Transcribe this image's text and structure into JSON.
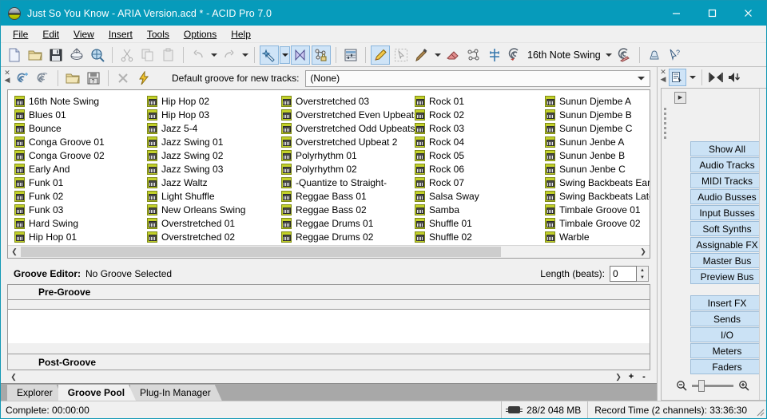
{
  "window": {
    "title": "Just So You Know - ARIA Version.acd * - ACID Pro 7.0",
    "app_icon": "acid-app-icon",
    "minimize": "–",
    "maximize": "□",
    "close": "✕",
    "accent_color": "#069bbb"
  },
  "menu": [
    {
      "label": "File",
      "accel": "F"
    },
    {
      "label": "Edit",
      "accel": "E"
    },
    {
      "label": "View",
      "accel": "V"
    },
    {
      "label": "Insert",
      "accel": "I"
    },
    {
      "label": "Tools",
      "accel": "T"
    },
    {
      "label": "Options",
      "accel": "O"
    },
    {
      "label": "Help",
      "accel": "H"
    }
  ],
  "toolbar": {
    "groove_label": "16th Note Swing",
    "items": [
      "new-icon",
      "open-folder-icon",
      "save-icon",
      "publish-icon",
      "properties-icon",
      "cut-icon",
      "copy-icon",
      "paste-icon",
      "undo-icon",
      "undo-dropdown-icon",
      "redo-icon",
      "redo-dropdown-icon",
      "enable-snapping-icon",
      "snapping-dropdown-icon",
      "auto-crossfades-icon",
      "automation-lock-icon",
      "mixing-console-icon",
      "draw-tool-icon",
      "selection-tool-icon",
      "paint-tool-icon",
      "paint-dropdown-icon",
      "eraser-tool-icon",
      "envelope-tool-icon",
      "time-selection-icon",
      "groove-tool-icon",
      "groove-dropdown-icon",
      "groove-erase-icon",
      "whats-this-icon",
      "help-pointer-icon"
    ]
  },
  "groove_pool": {
    "default_groove_label": "Default groove for new tracks:",
    "default_groove_value": "(None)",
    "toolbar_icons": [
      "new-groove-icon",
      "clone-groove-icon",
      "open-groove-icon",
      "save-groove-icon",
      "delete-groove-icon",
      "apply-groove-icon"
    ],
    "columns": [
      [
        "16th Note Swing",
        "Blues 01",
        "Bounce",
        "Conga Groove 01",
        "Conga Groove 02",
        "Early And",
        "Funk 01",
        "Funk 02",
        "Funk 03",
        "Hard Swing",
        "Hip Hop 01"
      ],
      [
        "Hip Hop 02",
        "Hip Hop 03",
        "Jazz 5-4",
        "Jazz Swing 01",
        "Jazz Swing 02",
        "Jazz Swing 03",
        "Jazz Waltz",
        "Light Shuffle",
        "New Orleans Swing",
        "Overstretched 01",
        "Overstretched 02"
      ],
      [
        "Overstretched 03",
        "Overstretched Even Upbeats",
        "Overstretched Odd Upbeats",
        "Overstretched Upbeat 2",
        "Polyrhythm 01",
        "Polyrhythm 02",
        "-Quantize to Straight-",
        "Reggae Bass 01",
        "Reggae Bass 02",
        "Reggae Drums 01",
        "Reggae Drums 02"
      ],
      [
        "Rock 01",
        "Rock 02",
        "Rock 03",
        "Rock 04",
        "Rock 05",
        "Rock 06",
        "Rock 07",
        "Salsa Sway",
        "Samba",
        "Shuffle 01",
        "Shuffle 02"
      ],
      [
        "Sunun Djembe A",
        "Sunun Djembe B",
        "Sunun Djembe C",
        "Sunun Jenbe A",
        "Sunun Jenbe B",
        "Sunun Jenbe C",
        "Swing Backbeats Early",
        "Swing Backbeats Late",
        "Timbale Groove 01",
        "Timbale Groove 02",
        "Warble"
      ]
    ]
  },
  "groove_editor": {
    "title": "Groove Editor:",
    "selection": "No Groove Selected",
    "length_label": "Length (beats):",
    "length_value": "0",
    "pre_groove": "Pre-Groove",
    "post_groove": "Post-Groove",
    "add_label": "+",
    "remove_label": "-"
  },
  "tabs": [
    {
      "label": "Explorer",
      "active": false
    },
    {
      "label": "Groove Pool",
      "active": true
    },
    {
      "label": "Plug-In Manager",
      "active": false
    }
  ],
  "mixer": {
    "toolbar_icons": [
      "mixer-view-icon",
      "mixer-view-dropdown-icon",
      "loop-region-icon",
      "volume-down-icon"
    ],
    "buttons_group_1": [
      "Show All",
      "Audio Tracks",
      "MIDI Tracks",
      "Audio Busses",
      "Input Busses",
      "Soft Synths",
      "Assignable FX",
      "Master Bus",
      "Preview Bus"
    ],
    "buttons_group_2": [
      "Insert FX",
      "Sends",
      "I/O",
      "Meters",
      "Faders"
    ],
    "zoom_out_icon": "zoom-out-icon",
    "zoom_in_icon": "zoom-in-icon",
    "button_color": "#cbe2f5"
  },
  "statusbar": {
    "status": "Complete: 00:00:00",
    "memory": "28/2 048 MB",
    "memory_icon": "memory-chip-icon",
    "record_time": "Record Time (2 channels): 33:36:30"
  }
}
